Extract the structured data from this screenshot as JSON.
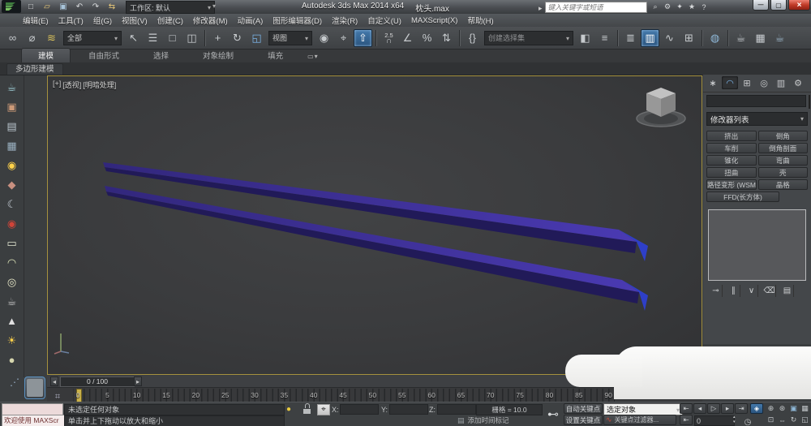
{
  "titlebar": {
    "app_title": "Autodesk 3ds Max  2014 x64",
    "doc_title": "枕头.max",
    "workspace": "工作区: 默认",
    "search_placeholder": "键入关键字或短语",
    "qat": [
      {
        "name": "new-file-icon",
        "glyph": "□"
      },
      {
        "name": "open-file-icon",
        "glyph": "▱",
        "color": "#e8c87a"
      },
      {
        "name": "save-file-icon",
        "glyph": "▣",
        "color": "#a8c4da"
      },
      {
        "name": "undo-icon",
        "glyph": "↶"
      },
      {
        "name": "redo-icon",
        "glyph": "↷"
      },
      {
        "name": "project-folder-icon",
        "glyph": "⇆",
        "color": "#e8c87a"
      }
    ],
    "search_icons": [
      {
        "name": "search-icon",
        "glyph": "⌕"
      },
      {
        "name": "wrench-icon",
        "glyph": "⚙"
      },
      {
        "name": "communication-center-icon",
        "glyph": "✦"
      },
      {
        "name": "favorites-star-icon",
        "glyph": "★"
      },
      {
        "name": "help-icon",
        "glyph": "?"
      }
    ]
  },
  "menus": [
    "编辑(E)",
    "工具(T)",
    "组(G)",
    "视图(V)",
    "创建(C)",
    "修改器(M)",
    "动画(A)",
    "图形编辑器(D)",
    "渲染(R)",
    "自定义(U)",
    "MAXScript(X)",
    "帮助(H)"
  ],
  "toolbar": {
    "selection_filter": "全部",
    "coord_system": "视图",
    "named_sets_placeholder": "创建选择集",
    "snap_value": "2.5",
    "g1": [
      {
        "name": "select-and-link-icon",
        "glyph": "∞"
      },
      {
        "name": "unlink-selection-icon",
        "glyph": "⌀"
      },
      {
        "name": "bind-to-spacewarp-icon",
        "glyph": "≋",
        "color": "#d8c05a"
      }
    ],
    "g2": [
      {
        "name": "select-object-icon",
        "glyph": "↖"
      },
      {
        "name": "select-by-name-icon",
        "glyph": "☰"
      },
      {
        "name": "rectangular-selection-region-icon",
        "glyph": "□"
      },
      {
        "name": "window-crossing-icon",
        "glyph": "◫"
      }
    ],
    "g3": [
      {
        "name": "select-and-move-icon",
        "glyph": "+"
      },
      {
        "name": "select-and-rotate-icon",
        "glyph": "↻"
      },
      {
        "name": "select-and-scale-icon",
        "glyph": "◱",
        "color": "#7ab4e8"
      }
    ],
    "g4": [
      {
        "name": "use-pivot-point-center-icon",
        "glyph": "◉"
      },
      {
        "name": "select-and-manipulate-icon",
        "glyph": "⌖"
      },
      {
        "name": "keyboard-override-toggle-icon",
        "glyph": "⇧",
        "active": true
      }
    ],
    "g5": [
      {
        "name": "angle-snap-icon",
        "glyph": "∠"
      },
      {
        "name": "percent-snap-icon",
        "glyph": "%"
      },
      {
        "name": "spinner-snap-icon",
        "glyph": "⇅"
      }
    ],
    "g6": [
      {
        "name": "edit-named-selection-sets-icon",
        "glyph": "{}"
      }
    ],
    "g7": [
      {
        "name": "mirror-icon",
        "glyph": "◧"
      },
      {
        "name": "align-icon",
        "glyph": "≡"
      }
    ],
    "g8": [
      {
        "name": "layer-manager-icon",
        "glyph": "≣"
      },
      {
        "name": "graphite-ribbon-toggle-icon",
        "glyph": "▥",
        "active": true
      },
      {
        "name": "curve-editor-icon",
        "glyph": "∿"
      },
      {
        "name": "schematic-view-icon",
        "glyph": "⊞"
      }
    ],
    "g9": [
      {
        "name": "material-editor-icon",
        "glyph": "◍",
        "color": "#8fb8d8"
      }
    ],
    "g10": [
      {
        "name": "render-setup-icon",
        "glyph": "☕",
        "color": "#c8ccd0"
      },
      {
        "name": "rendered-frame-window-icon",
        "glyph": "▦",
        "color": "#c8ccd0"
      },
      {
        "name": "render-production-icon",
        "glyph": "☕",
        "color": "#9db8cc"
      }
    ]
  },
  "ribbon": {
    "tabs": [
      {
        "label": "建模",
        "active": true
      },
      {
        "label": "自由形式"
      },
      {
        "label": "选择"
      },
      {
        "label": "对象绘制"
      },
      {
        "label": "填充"
      }
    ],
    "panel_tab": "多边形建模"
  },
  "left_toolbar": [
    {
      "name": "render-teapot-icon",
      "glyph": "☕",
      "color": "#9fd0d8"
    },
    {
      "name": "viewport-image-icon",
      "glyph": "▣",
      "color": "#cc9977"
    },
    {
      "name": "list-editor-icon",
      "glyph": "▤",
      "color": "#b8c4cc"
    },
    {
      "name": "table-grid-icon",
      "glyph": "▦",
      "color": "#9ab0c0"
    },
    {
      "name": "light-lister-icon",
      "glyph": "◉",
      "color": "#ffd24a"
    },
    {
      "name": "camera-sound-icon",
      "glyph": "◆",
      "color": "#c89080"
    },
    {
      "name": "moon-icon",
      "glyph": "☾",
      "color": "#ccd4dc"
    },
    {
      "name": "video-camera-icon",
      "glyph": "◉",
      "color": "#d04438"
    },
    {
      "name": "plane-icon",
      "glyph": "▭",
      "color": "#e0e4d0"
    },
    {
      "name": "dome-icon",
      "glyph": "◠",
      "color": "#dde4b8"
    },
    {
      "name": "torus-icon",
      "glyph": "◎",
      "color": "#e6e6c6"
    },
    {
      "name": "teapot-outline-icon",
      "glyph": "☕",
      "color": "#c8c8c8"
    },
    {
      "name": "cone-icon",
      "glyph": "▲",
      "color": "#e0e0e0"
    },
    {
      "name": "sun-icon",
      "glyph": "☀",
      "color": "#ffd24a"
    },
    {
      "name": "sphere-icon",
      "glyph": "●",
      "color": "#d6d6ae"
    }
  ],
  "viewport": {
    "menus": [
      {
        "name": "viewport-general-menu",
        "label": "[+]"
      },
      {
        "name": "viewport-pov-menu",
        "label": "[透视]"
      },
      {
        "name": "viewport-shading-menu",
        "label": "[明暗处理]"
      }
    ],
    "colors": {
      "top": "#4a3ab2",
      "top_dark": "#32277c",
      "side": "#211a58",
      "cap": "#2e3fc8"
    }
  },
  "command_panel": {
    "tabs": [
      {
        "name": "create-tab-icon",
        "glyph": "∗",
        "color": "#d8dadc"
      },
      {
        "name": "modify-tab-icon",
        "glyph": "◠",
        "color": "#7ab4e8",
        "active": true
      },
      {
        "name": "hierarchy-tab-icon",
        "glyph": "⊞"
      },
      {
        "name": "motion-tab-icon",
        "glyph": "◎"
      },
      {
        "name": "display-tab-icon",
        "glyph": "▥"
      },
      {
        "name": "utilities-tab-icon",
        "glyph": "⚙"
      }
    ],
    "modifier_list_label": "修改器列表",
    "modifier_buttons": [
      "挤出",
      "倒角",
      "车削",
      "倒角剖面",
      "锥化",
      "弯曲",
      "扭曲",
      "壳",
      "路径变形 (WSM)",
      "晶格",
      "FFD(长方体)"
    ],
    "stack_icons": [
      {
        "name": "pin-stack-icon",
        "glyph": "⊸"
      },
      {
        "name": "show-end-result-icon",
        "glyph": "∥"
      },
      {
        "name": "make-unique-icon",
        "glyph": "∨"
      },
      {
        "name": "remove-modifier-icon",
        "glyph": "⌫"
      },
      {
        "name": "configure-modifier-sets-icon",
        "glyph": "▤"
      }
    ]
  },
  "timeline": {
    "slider_value": "0 / 100",
    "tick_labels": [
      "0",
      "5",
      "10",
      "15",
      "20",
      "25",
      "30",
      "35",
      "40",
      "45",
      "50",
      "55",
      "60",
      "65",
      "70",
      "75",
      "80",
      "85",
      "90"
    ]
  },
  "status": {
    "listener_text": "欢迎使用 MAXScr",
    "selection_status": "未选定任何对象",
    "prompt": "单击并上下拖动以放大和缩小",
    "x_label": "X:",
    "y_label": "Y:",
    "z_label": "Z:",
    "grid_label": "栅格 = 10.0",
    "add_time_tag": "添加时间标记",
    "auto_key": "自动关键点",
    "set_key": "设置关键点",
    "selection_set_value": "选定对象",
    "key_filters": "关键点过滤器...",
    "frame_value": "0",
    "playback": [
      {
        "name": "go-to-start-icon",
        "glyph": "⇤"
      },
      {
        "name": "previous-frame-icon",
        "glyph": "◂"
      },
      {
        "name": "play-icon",
        "glyph": "▷"
      },
      {
        "name": "next-frame-icon",
        "glyph": "▸"
      },
      {
        "name": "go-to-end-icon",
        "glyph": "⇥"
      }
    ],
    "nav_row1": [
      {
        "name": "zoom-icon",
        "glyph": "⊕"
      },
      {
        "name": "zoom-all-icon",
        "glyph": "⊛"
      },
      {
        "name": "zoom-extents-icon",
        "glyph": "▣",
        "color": "#8fb8d8"
      },
      {
        "name": "zoom-extents-all-icon",
        "glyph": "▦"
      }
    ],
    "nav_row2": [
      {
        "name": "zoom-region-icon",
        "glyph": "⊡"
      },
      {
        "name": "pan-hand-icon",
        "glyph": "⇔"
      },
      {
        "name": "orbit-icon",
        "glyph": "↻"
      },
      {
        "name": "maximize-viewport-icon",
        "glyph": "◱"
      }
    ]
  }
}
